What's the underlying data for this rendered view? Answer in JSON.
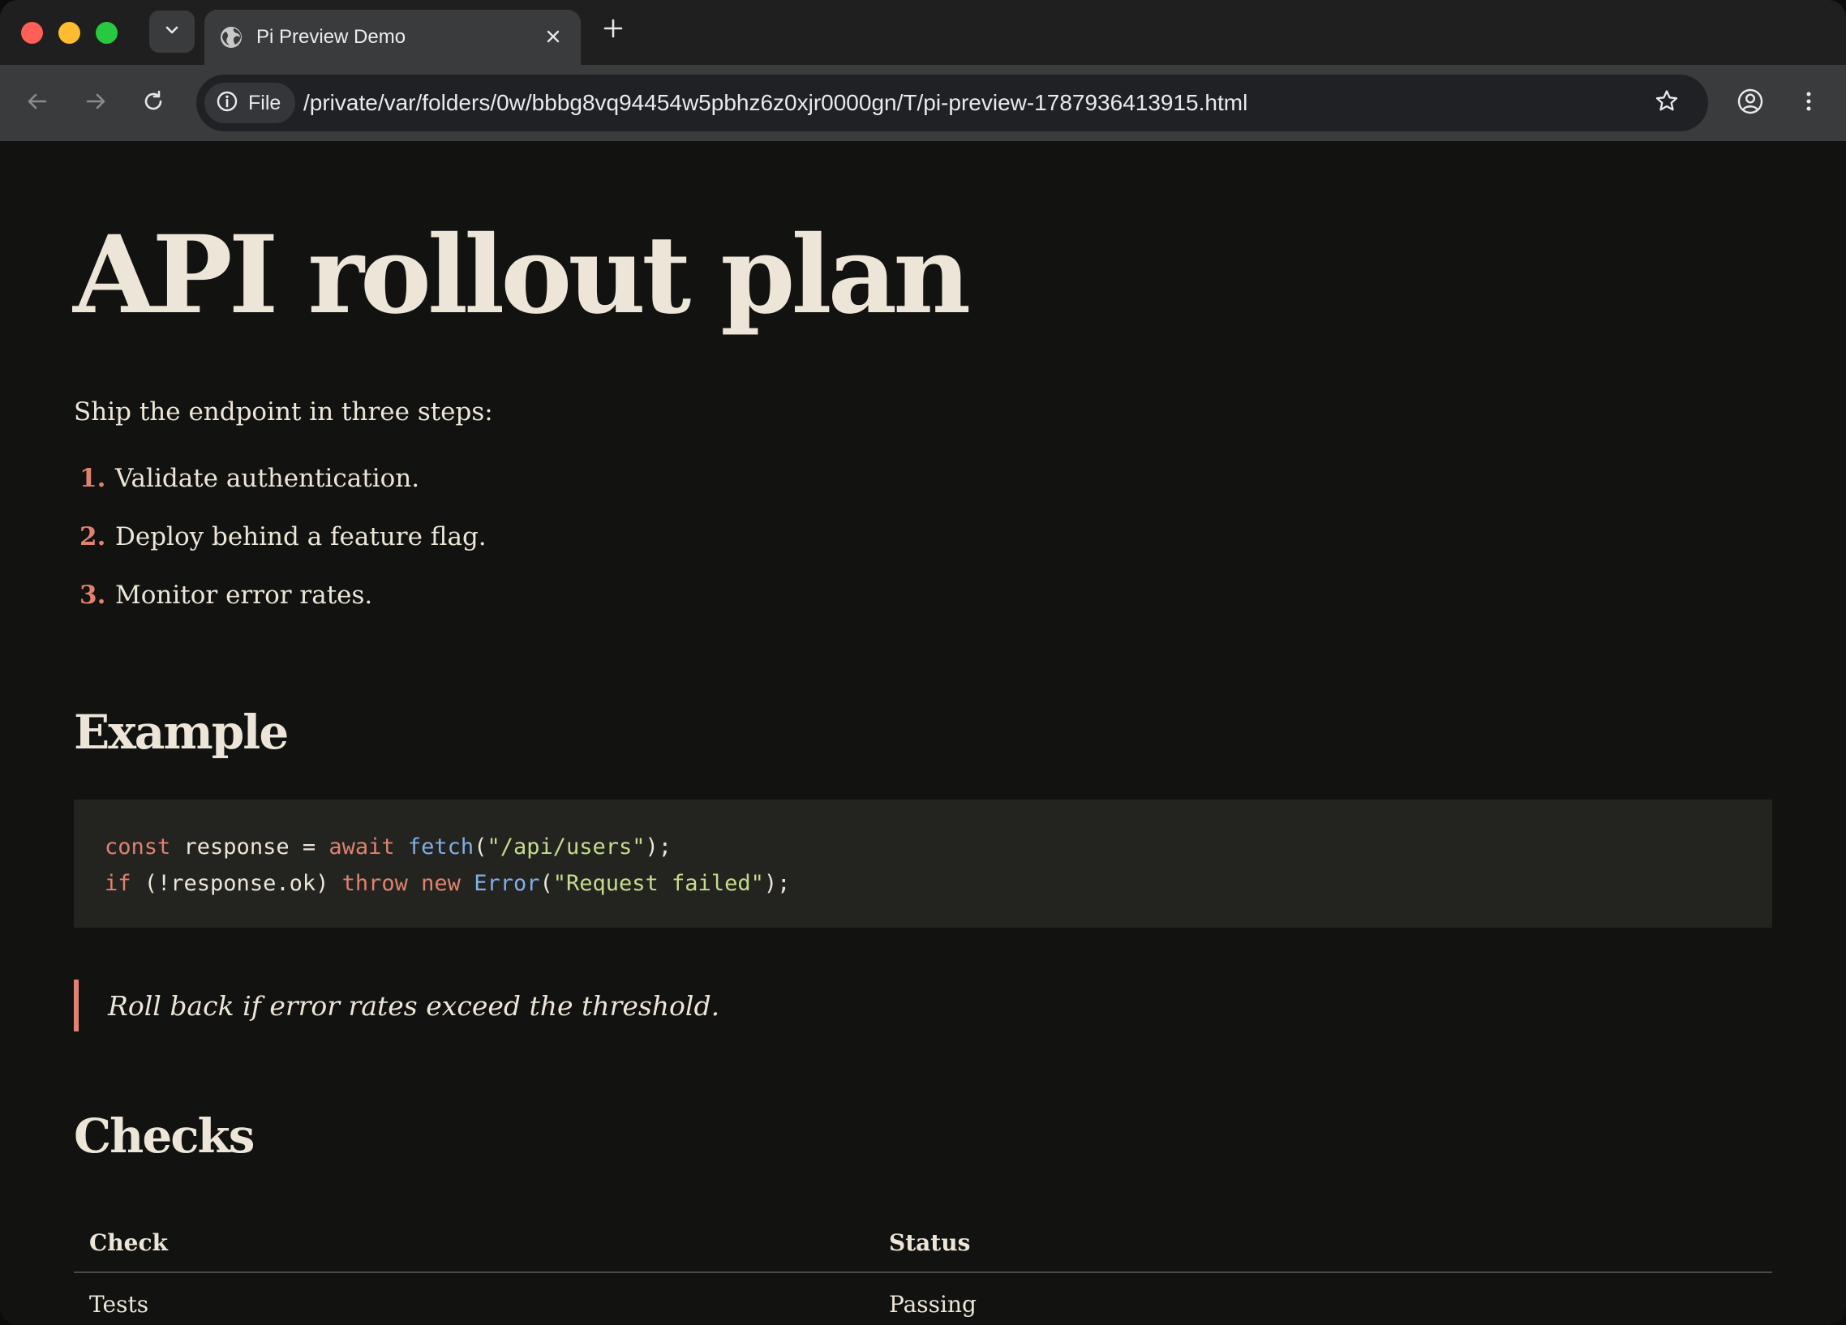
{
  "browser": {
    "tab": {
      "title": "Pi Preview Demo"
    },
    "address_bar": {
      "chip_label": "File",
      "url": "/private/var/folders/0w/bbbg8vq94454w5pbhz6z0xjr0000gn/T/pi-preview-1787936413915.html"
    },
    "icons": [
      "tab-search-icon",
      "globe-icon",
      "close-icon",
      "plus-icon",
      "back-icon",
      "forward-icon",
      "reload-icon",
      "info-icon",
      "star-icon",
      "profile-icon",
      "menu-icon"
    ]
  },
  "page": {
    "title": "API rollout plan",
    "intro": "Ship the endpoint in three steps:",
    "steps": [
      {
        "num": "1.",
        "text": "Validate authentication."
      },
      {
        "num": "2.",
        "text": "Deploy behind a feature flag."
      },
      {
        "num": "3.",
        "text": "Monitor error rates."
      }
    ],
    "example_heading": "Example",
    "code": {
      "line1": {
        "kw1": "const",
        "t1": " response = ",
        "kw2": "await",
        "t2": " ",
        "fn": "fetch",
        "t3": "(",
        "str": "\"/api/users\"",
        "t4": ");"
      },
      "line2": {
        "kw1": "if",
        "t1": " (!response.ok) ",
        "kw2": "throw",
        "t2": " ",
        "kw3": "new",
        "t3": " ",
        "fn": "Error",
        "t4": "(",
        "str": "\"Request failed\"",
        "t5": ");"
      }
    },
    "quote": "Roll back if error rates exceed the threshold.",
    "checks_heading": "Checks",
    "table": {
      "headers": [
        "Check",
        "Status"
      ],
      "rows": [
        [
          "Tests",
          "Passing"
        ]
      ]
    }
  },
  "colors": {
    "background": "#121210",
    "text": "#ede6d8",
    "accent": "#e0826f",
    "code_bg": "#232320",
    "code_function": "#82aee6",
    "code_string": "#c6dc8c"
  }
}
